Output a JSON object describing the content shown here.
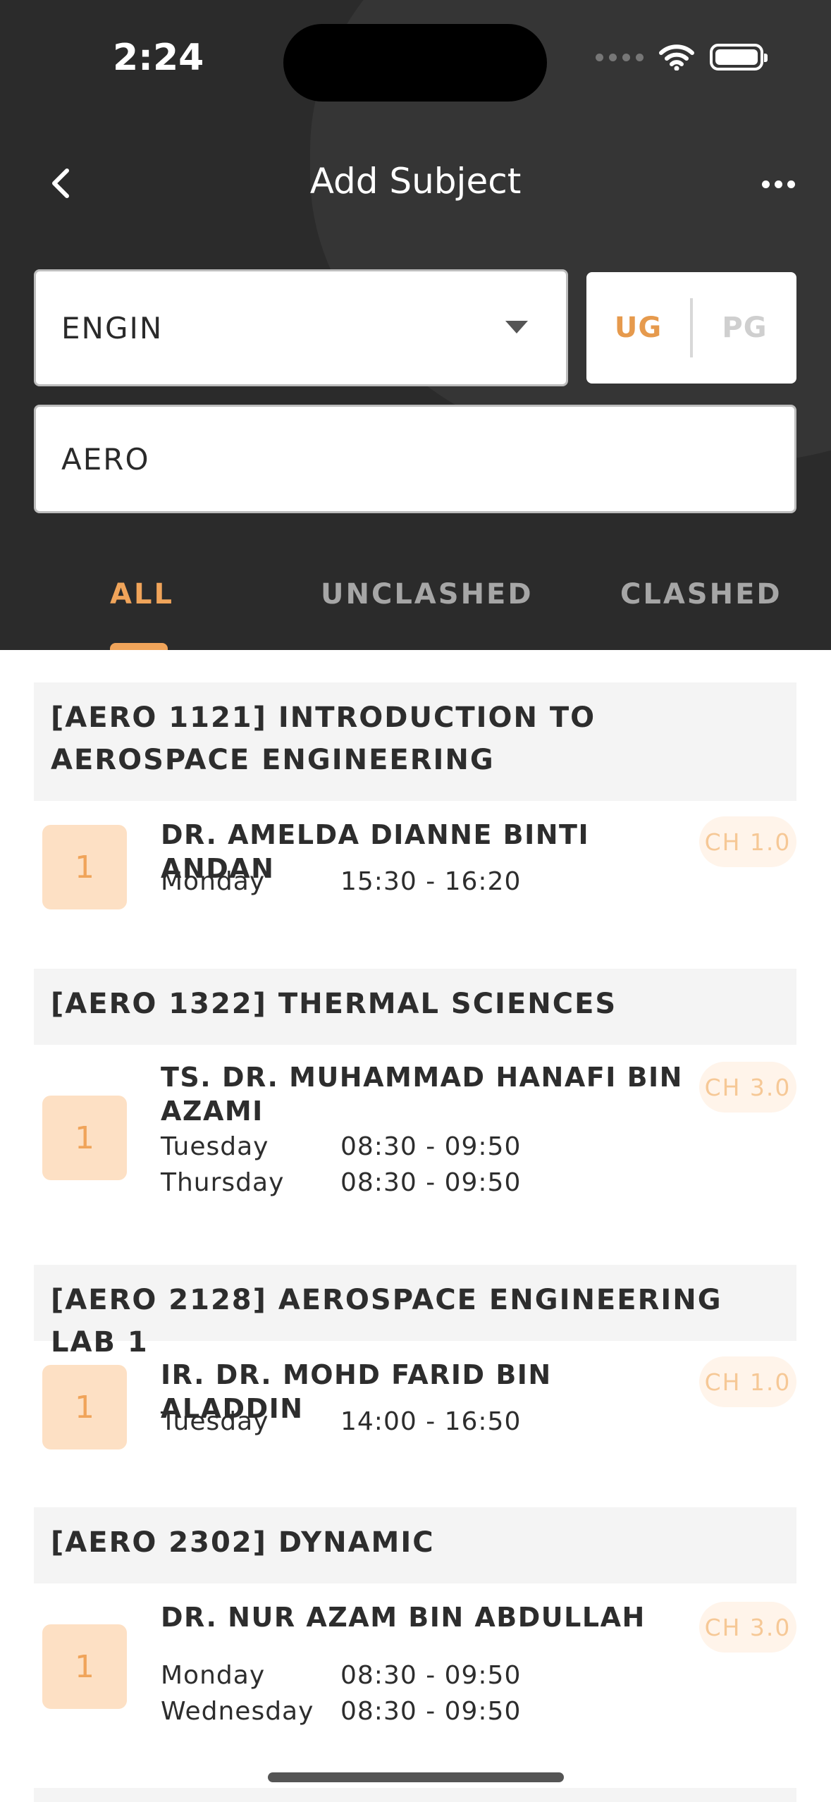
{
  "status_bar": {
    "time": "2:24"
  },
  "nav": {
    "title": "Add Subject"
  },
  "filters": {
    "department": "ENGIN",
    "levels": [
      "UG",
      "PG"
    ],
    "selected_level": "UG",
    "search_value": "AERO"
  },
  "tabs": [
    {
      "label": "ALL",
      "active": true
    },
    {
      "label": "UNCLASHED",
      "active": false
    },
    {
      "label": "CLASHED",
      "active": false
    }
  ],
  "courses": [
    {
      "title": "[AERO 1121] INTRODUCTION TO AEROSPACE ENGINEERING",
      "section": "1",
      "lecturer": "DR. AMELDA DIANNE BINTI ANDAN",
      "credit": "CH 1.0",
      "slots": [
        {
          "day": "Monday",
          "time": "15:30 - 16:20"
        }
      ]
    },
    {
      "title": "[AERO 1322] THERMAL SCIENCES",
      "section": "1",
      "lecturer": "TS. DR. MUHAMMAD HANAFI BIN AZAMI",
      "credit": "CH 3.0",
      "slots": [
        {
          "day": "Tuesday",
          "time": "08:30 - 09:50"
        },
        {
          "day": "Thursday",
          "time": "08:30 - 09:50"
        }
      ]
    },
    {
      "title": "[AERO 2128] AEROSPACE ENGINEERING LAB 1",
      "section": "1",
      "lecturer": "IR. DR. MOHD FARID BIN ALADDIN",
      "credit": "CH 1.0",
      "slots": [
        {
          "day": "Tuesday",
          "time": "14:00 - 16:50"
        }
      ]
    },
    {
      "title": "[AERO 2302] DYNAMIC",
      "section": "1",
      "lecturer": "DR. NUR AZAM BIN ABDULLAH",
      "credit": "CH 3.0",
      "slots": [
        {
          "day": "Monday",
          "time": "08:30 - 09:50"
        },
        {
          "day": "Wednesday",
          "time": "08:30 - 09:50"
        }
      ]
    }
  ],
  "colors": {
    "header_bg": "#2b2b2b",
    "accent": "#f0a45a",
    "section_badge_bg": "#fde0c4",
    "course_header_bg": "#f4f4f4"
  }
}
